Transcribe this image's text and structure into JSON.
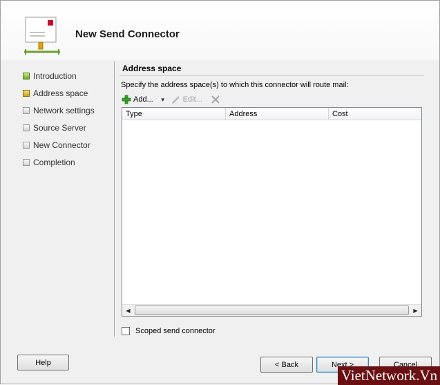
{
  "window": {
    "title": "New Send Connector"
  },
  "steps": [
    {
      "label": "Introduction",
      "state": "done"
    },
    {
      "label": "Address space",
      "state": "current"
    },
    {
      "label": "Network settings",
      "state": "pending"
    },
    {
      "label": "Source Server",
      "state": "pending"
    },
    {
      "label": "New Connector",
      "state": "pending"
    },
    {
      "label": "Completion",
      "state": "pending"
    }
  ],
  "main": {
    "section_title": "Address space",
    "description": "Specify the address space(s) to which this connector will route mail:",
    "toolbar": {
      "add_label": "Add...",
      "edit_label": "Edit...",
      "icons": [
        "plus-icon",
        "chevron-down-icon",
        "pencil-icon",
        "delete-icon"
      ]
    },
    "grid": {
      "columns": [
        "Type",
        "Address",
        "Cost"
      ],
      "rows": []
    },
    "scoped_label": "Scoped send connector",
    "scoped_checked": false
  },
  "buttons": {
    "help": "Help",
    "back": "< Back",
    "next": "Next >",
    "cancel": "Cancel"
  },
  "watermark": "VietNetwork.Vn",
  "colors": {
    "step_done": "#6fa62a",
    "step_current": "#caa01d",
    "watermark_bg": "#6a0f12"
  }
}
